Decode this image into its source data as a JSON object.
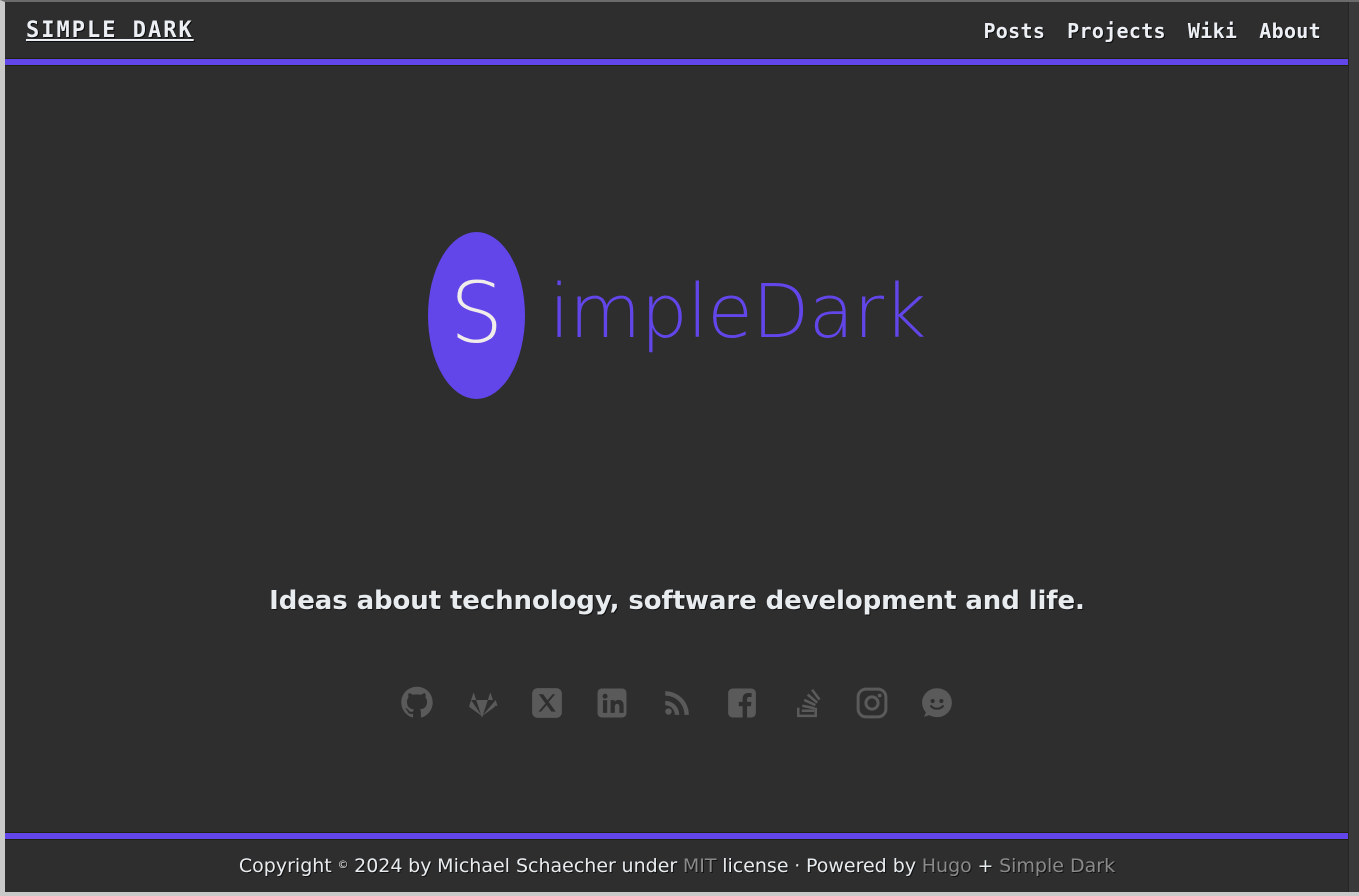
{
  "site": {
    "brand": "SIMPLE DARK",
    "logo_letter": "S",
    "logo_word": "impleDark",
    "tagline": "Ideas about technology, software development and life.",
    "accent_color": "#6246ea",
    "background_color": "#2e2e2e",
    "text_color": "#e8ecef",
    "muted_color": "#8a8a8a",
    "icon_color": "#5a5a5a"
  },
  "nav": {
    "items": [
      {
        "label": "Posts"
      },
      {
        "label": "Projects"
      },
      {
        "label": "Wiki"
      },
      {
        "label": "About"
      }
    ]
  },
  "socials": {
    "items": [
      {
        "name": "github-icon",
        "label": "GitHub"
      },
      {
        "name": "gitlab-icon",
        "label": "GitLab"
      },
      {
        "name": "x-twitter-icon",
        "label": "X"
      },
      {
        "name": "linkedin-icon",
        "label": "LinkedIn"
      },
      {
        "name": "rss-icon",
        "label": "RSS"
      },
      {
        "name": "facebook-icon",
        "label": "Facebook"
      },
      {
        "name": "stack-overflow-icon",
        "label": "Stack Overflow"
      },
      {
        "name": "instagram-icon",
        "label": "Instagram"
      },
      {
        "name": "reddit-icon",
        "label": "Reddit"
      }
    ]
  },
  "footer": {
    "copyright_word": "Copyright",
    "copyright_symbol": "©",
    "year": "2024",
    "by": "by",
    "author": "Michael Schaecher",
    "under": "under",
    "license_link": "MIT",
    "license_word": "license",
    "separator": "·",
    "powered_by": "Powered by",
    "generator_link": "Hugo",
    "plus": "+",
    "theme_link": "Simple Dark"
  }
}
